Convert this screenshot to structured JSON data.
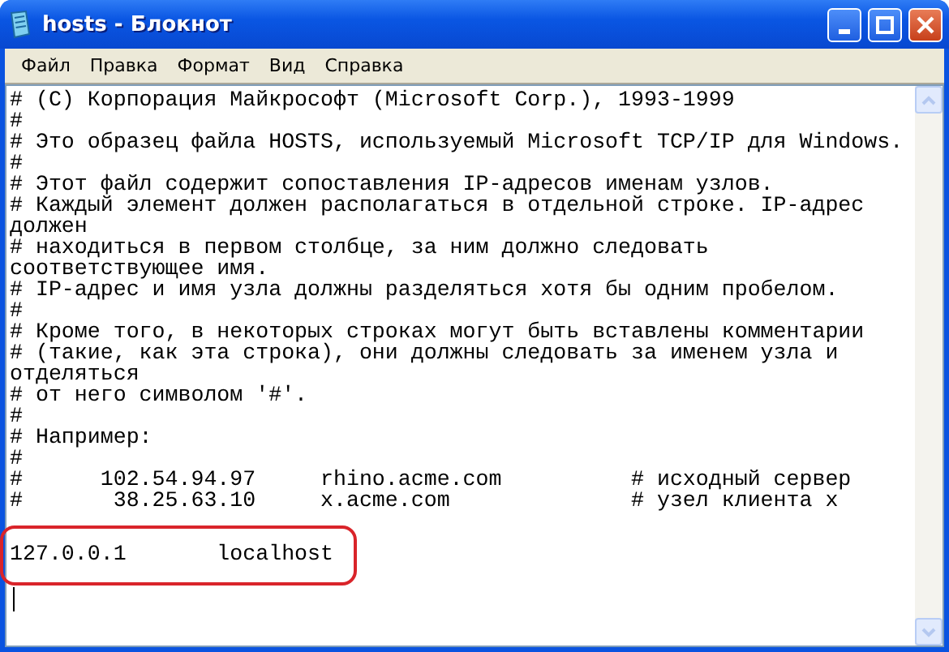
{
  "window": {
    "title": "hosts - Блокнот"
  },
  "menu": [
    "Файл",
    "Правка",
    "Формат",
    "Вид",
    "Справка"
  ],
  "lines": [
    {
      "kind": "text",
      "text": "# (C) Корпорация Майкрософт (Microsoft Corp.), 1993-1999",
      "highlighted": false
    },
    {
      "kind": "text",
      "text": "#",
      "highlighted": false
    },
    {
      "kind": "text",
      "text": "# Это образец файла HOSTS, используемый Microsoft TCP/IP для Windows.",
      "highlighted": false
    },
    {
      "kind": "text",
      "text": "#",
      "highlighted": false
    },
    {
      "kind": "text",
      "text": "# Этот файл содержит сопоставления IP-адресов именам узлов.",
      "highlighted": false
    },
    {
      "kind": "text",
      "text": "# Каждый элемент должен располагаться в отдельной строке. IP-адрес",
      "highlighted": false
    },
    {
      "kind": "text",
      "text": "должен",
      "highlighted": false
    },
    {
      "kind": "text",
      "text": "# находиться в первом столбце, за ним должно следовать",
      "highlighted": false
    },
    {
      "kind": "text",
      "text": "соответствующее имя.",
      "highlighted": false
    },
    {
      "kind": "text",
      "text": "# IP-адрес и имя узла должны разделяться хотя бы одним пробелом.",
      "highlighted": false
    },
    {
      "kind": "text",
      "text": "#",
      "highlighted": false
    },
    {
      "kind": "text",
      "text": "# Кроме того, в некоторых строках могут быть вставлены комментарии",
      "highlighted": false
    },
    {
      "kind": "text",
      "text": "# (такие, как эта строка), они должны следовать за именем узла и",
      "highlighted": false
    },
    {
      "kind": "text",
      "text": "отделяться",
      "highlighted": false
    },
    {
      "kind": "text",
      "text": "# от него символом '#'.",
      "highlighted": false
    },
    {
      "kind": "text",
      "text": "#",
      "highlighted": false
    },
    {
      "kind": "text",
      "text": "# Например:",
      "highlighted": false
    },
    {
      "kind": "text",
      "text": "#",
      "highlighted": false
    },
    {
      "kind": "text",
      "text": "#      102.54.94.97     rhino.acme.com          # исходный сервер",
      "highlighted": false
    },
    {
      "kind": "text",
      "text": "#       38.25.63.10     x.acme.com              # узел клиента x",
      "highlighted": false
    },
    {
      "kind": "blank"
    },
    {
      "kind": "text",
      "text": "127.0.0.1       localhost",
      "highlighted": true
    },
    {
      "kind": "caret"
    }
  ]
}
